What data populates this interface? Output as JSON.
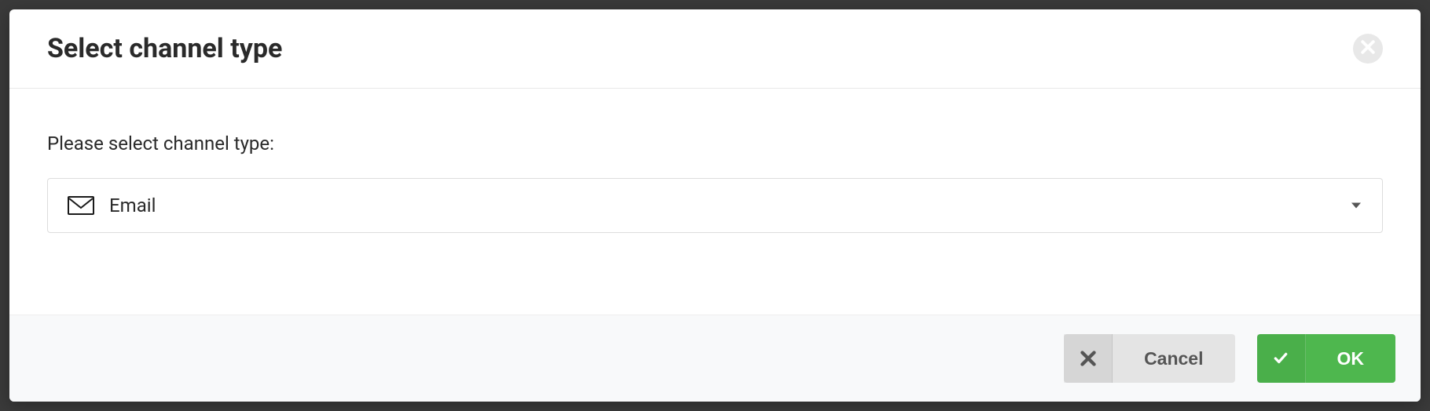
{
  "modal": {
    "title": "Select channel type",
    "prompt": "Please select channel type:",
    "select": {
      "value": "Email",
      "icon": "envelope-icon"
    },
    "buttons": {
      "cancel": "Cancel",
      "ok": "OK"
    }
  }
}
